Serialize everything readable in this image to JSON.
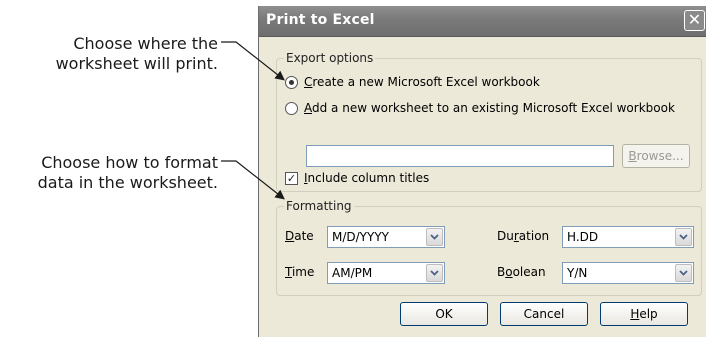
{
  "callouts": {
    "first": [
      "Choose where the",
      "worksheet will print."
    ],
    "second": [
      "Choose how to format",
      "data in the worksheet."
    ]
  },
  "dialog": {
    "title": "Print to Excel",
    "close_glyph": "✕",
    "export_options": {
      "legend": "Export options",
      "create_new": {
        "accel": "C",
        "rest": "reate a new Microsoft Excel workbook",
        "checked": true
      },
      "add_existing": {
        "accel": "A",
        "rest": "dd a new worksheet to an existing Microsoft Excel workbook",
        "checked": false
      },
      "path_value": "",
      "browse": {
        "accel": "B",
        "rest": "rowse...",
        "enabled": false
      },
      "include_titles": {
        "accel": "I",
        "rest": "nclude column titles",
        "checked": true,
        "check_glyph": "✓"
      }
    },
    "formatting": {
      "legend": "Formatting",
      "date": {
        "accel": "D",
        "rest": "ate",
        "value": "M/D/YYYY"
      },
      "time": {
        "accel": "T",
        "rest": "ime",
        "value": "AM/PM"
      },
      "duration": {
        "pre": "Du",
        "accel": "r",
        "rest": "ation",
        "value": "H.DD"
      },
      "boolean": {
        "pre": "B",
        "accel": "o",
        "rest": "olean",
        "value": "Y/N"
      }
    },
    "buttons": {
      "ok": "OK",
      "cancel": "Cancel",
      "help": {
        "accel": "H",
        "rest": "elp"
      }
    }
  },
  "colors": {
    "dialog_bg": "#ece9d8",
    "titlebar": "#7a7a7a",
    "field_border": "#7f9db9"
  }
}
